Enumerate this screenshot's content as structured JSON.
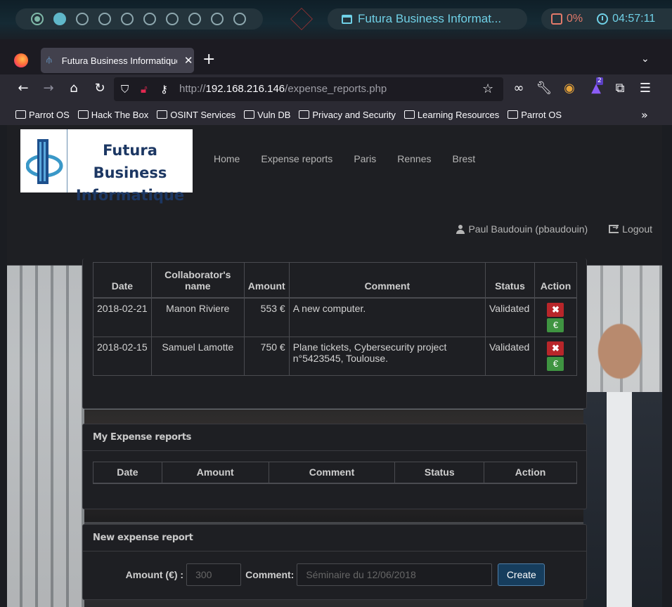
{
  "system_panel": {
    "window_title": "Futura Business Informat...",
    "cpu": "0%",
    "clock": "04:57:11"
  },
  "browser": {
    "tab_title": "Futura Business Informatique",
    "url_prefix": "http://",
    "url_host": "192.168.216.146",
    "url_path": "/expense_reports.php",
    "bookmarks": [
      "Parrot OS",
      "Hack The Box",
      "OSINT Services",
      "Vuln DB",
      "Privacy and Security",
      "Learning Resources",
      "Parrot OS"
    ],
    "extension_badge": "2"
  },
  "site": {
    "logo_line1": "Futura Business",
    "logo_line2": "Informatique",
    "nav": [
      "Home",
      "Expense reports",
      "Paris",
      "Rennes",
      "Brest"
    ],
    "user": "Paul Baudouin (pbaudouin)",
    "logout": "Logout"
  },
  "team_reports": {
    "headers": [
      "Date",
      "Collaborator's name",
      "Amount",
      "Comment",
      "Status",
      "Action"
    ],
    "rows": [
      {
        "date": "2018-02-21",
        "name": "Manon Riviere",
        "amount": "553 €",
        "comment": "A new computer.",
        "status": "Validated"
      },
      {
        "date": "2018-02-15",
        "name": "Samuel Lamotte",
        "amount": "750 €",
        "comment": "Plane tickets, Cybersecurity project n°5423545, Toulouse.",
        "status": "Validated"
      }
    ],
    "reject_symbol": "✖",
    "pay_symbol": "€"
  },
  "my_reports": {
    "title": "My Expense reports",
    "headers": [
      "Date",
      "Amount",
      "Comment",
      "Status",
      "Action"
    ]
  },
  "new_report": {
    "title": "New expense report",
    "amount_label": "Amount (€) :",
    "amount_placeholder": "300",
    "comment_label": "Comment:",
    "comment_placeholder": "Séminaire du 12/06/2018",
    "submit": "Create"
  }
}
